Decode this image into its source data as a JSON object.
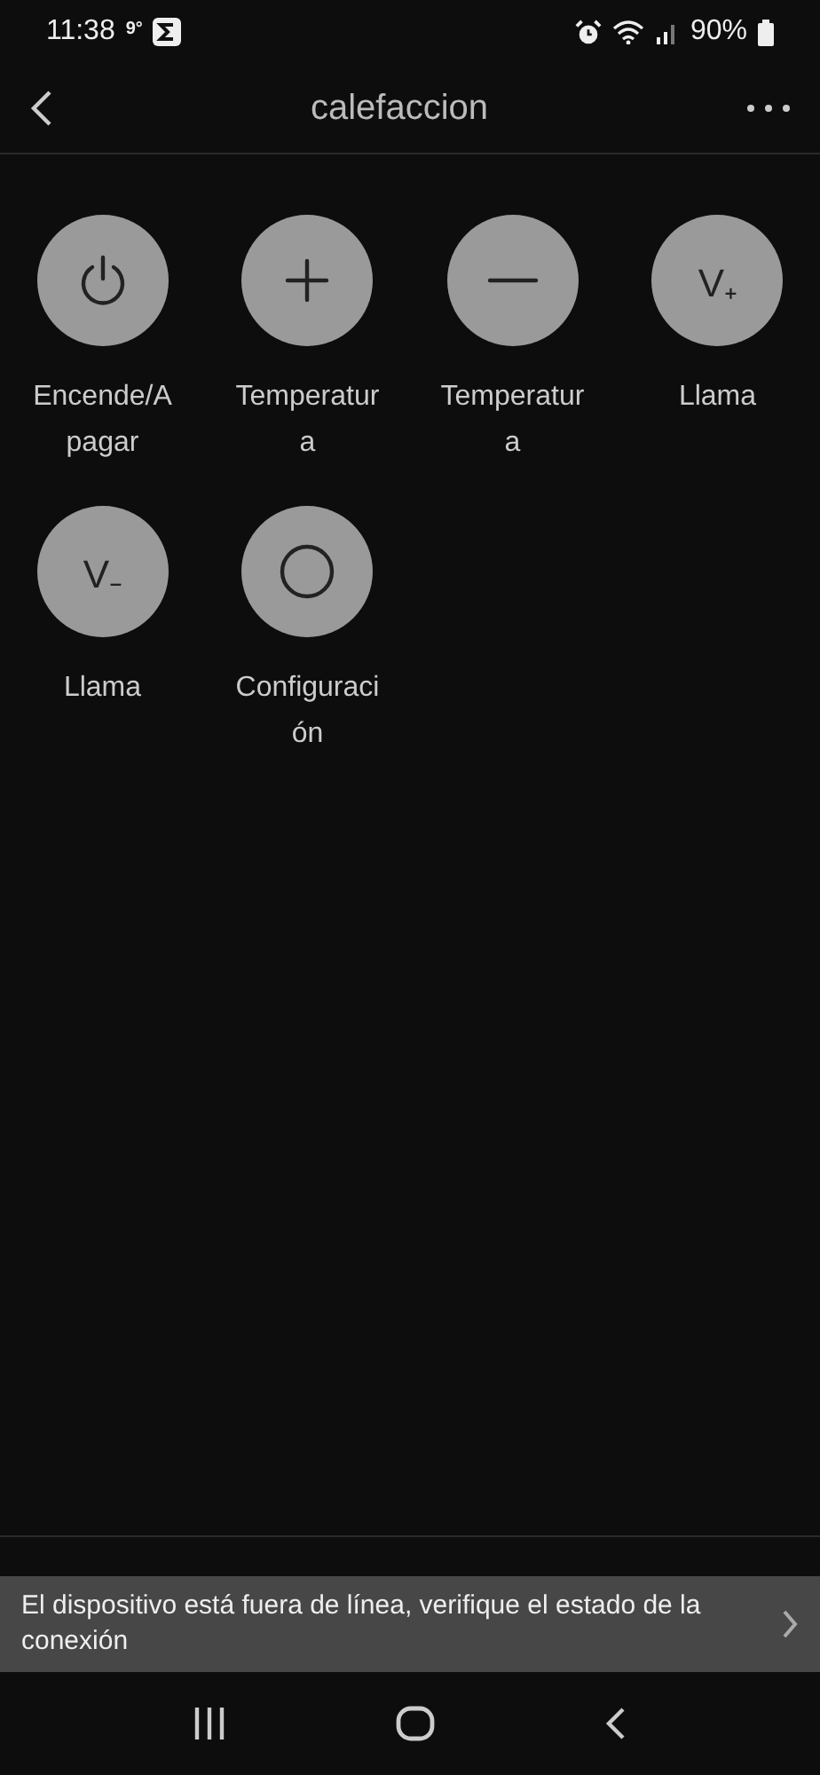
{
  "status_bar": {
    "time": "11:38",
    "temperature": "9°",
    "battery": "90%"
  },
  "header": {
    "title": "calefaccion"
  },
  "controls": [
    {
      "kind": "power",
      "label": "Encende/A\npagar"
    },
    {
      "kind": "plus",
      "label": "Temperatur\na"
    },
    {
      "kind": "minus",
      "label": "Temperatur\na"
    },
    {
      "kind": "glyph",
      "glyph": "V₊",
      "label": "Llama"
    },
    {
      "kind": "glyph",
      "glyph": "V₋",
      "label": "Llama"
    },
    {
      "kind": "ring",
      "label": "Configuraci\nón"
    }
  ],
  "banner": {
    "message": "El dispositivo está fuera de línea, verifique el estado de la conexión"
  }
}
